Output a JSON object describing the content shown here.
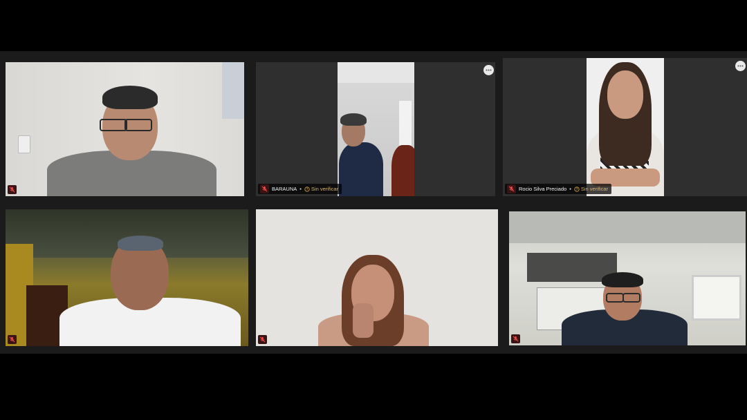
{
  "participants": [
    {
      "name": "",
      "muted": true
    },
    {
      "name": "BARAUNA",
      "muted": true,
      "status": "Sin verificar"
    },
    {
      "name": "Rocio Silva Preciado",
      "muted": true,
      "status": "Sin verificar"
    },
    {
      "name": "",
      "muted": true
    },
    {
      "name": "",
      "muted": true
    },
    {
      "name": "",
      "muted": true
    }
  ],
  "separator": "•",
  "icons": {
    "mute": "mic-off-icon",
    "more": "more-options-icon",
    "status": "help-circle-icon"
  },
  "colors": {
    "background": "#000000",
    "tile": "#2f2f2f",
    "status": "#e8b14a",
    "mute": "#e84a4a"
  }
}
